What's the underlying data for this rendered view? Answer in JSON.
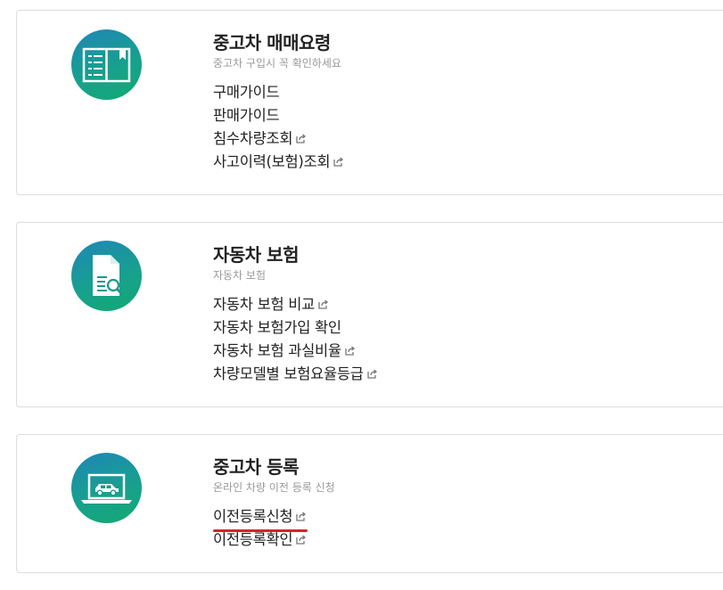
{
  "sections": [
    {
      "title": "중고차 매매요령",
      "subtitle": "중고차 구입시 꼭 확인하세요",
      "icon": "book-icon",
      "links": [
        {
          "label": "구매가이드",
          "external": false
        },
        {
          "label": "판매가이드",
          "external": false
        },
        {
          "label": "침수차량조회",
          "external": true
        },
        {
          "label": "사고이력(보험)조회",
          "external": true
        }
      ]
    },
    {
      "title": "자동차 보험",
      "subtitle": "자동차 보험",
      "icon": "document-search-icon",
      "links": [
        {
          "label": "자동차 보험 비교",
          "external": true
        },
        {
          "label": "자동차 보험가입 확인",
          "external": false
        },
        {
          "label": "자동차 보험 과실비율",
          "external": true
        },
        {
          "label": "차량모델별 보험요율등급",
          "external": true
        }
      ]
    },
    {
      "title": "중고차 등록",
      "subtitle": "온라인 차량 이전 등록 신청",
      "icon": "laptop-car-icon",
      "links": [
        {
          "label": "이전등록신청",
          "external": true,
          "highlighted": true
        },
        {
          "label": "이전등록확인",
          "external": true
        }
      ]
    }
  ],
  "colors": {
    "icon_gradient_start": "#1f86b8",
    "icon_gradient_end": "#12a873",
    "highlight_underline": "#d8232a"
  }
}
